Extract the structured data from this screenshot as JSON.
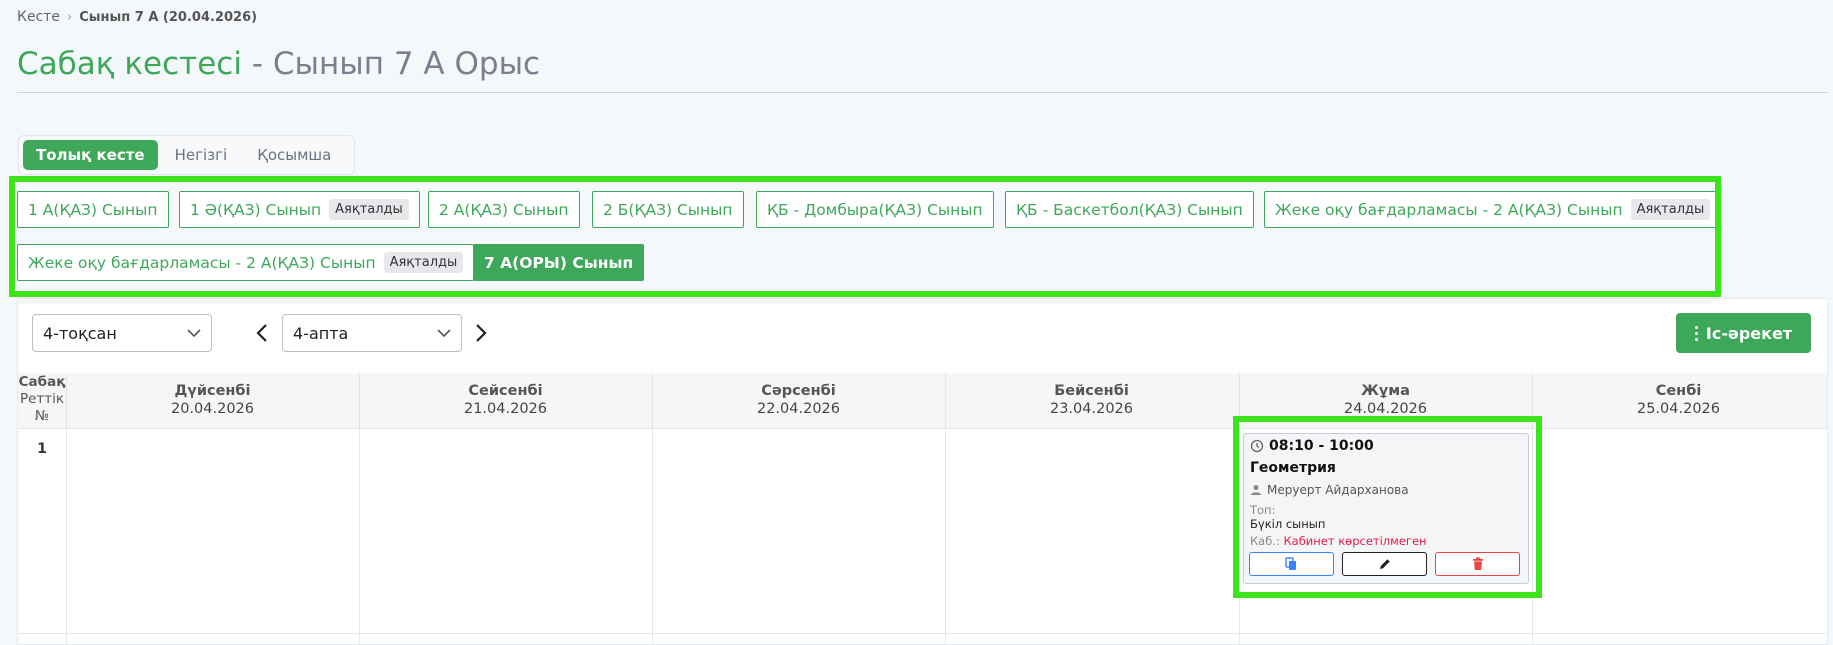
{
  "breadcrumb": {
    "root": "Кесте",
    "current": "Сынып 7 А (20.04.2026)"
  },
  "title": {
    "main": "Сабақ кестесі",
    "suffix": "- Сынып 7 А Орыс"
  },
  "tabs": [
    {
      "label": "Толық кесте",
      "active": true
    },
    {
      "label": "Негізгі",
      "active": false
    },
    {
      "label": "Қосымша",
      "active": false
    }
  ],
  "classes": [
    {
      "label": "1 А(ҚАЗ) Сынып",
      "badge": ""
    },
    {
      "label": "1 Ә(ҚАЗ) Сынып",
      "badge": "Аяқталды"
    },
    {
      "label": "2 А(ҚАЗ) Сынып",
      "badge": ""
    },
    {
      "label": "2 Б(ҚАЗ) Сынып",
      "badge": ""
    },
    {
      "label": "ҚБ - Домбыра(ҚАЗ) Сынып",
      "badge": ""
    },
    {
      "label": "ҚБ - Баскетбол(ҚАЗ) Сынып",
      "badge": ""
    },
    {
      "label": "Жеке оқу бағдарламасы - 2 А(ҚАЗ) Сынып",
      "badge": "Аяқталды"
    },
    {
      "label": "Жеке оқу бағдарламасы - 2 А(ҚАЗ) Сынып",
      "badge": "Аяқталды"
    },
    {
      "label": "7 А(ОРЫ) Сынып",
      "badge": "",
      "active": true
    }
  ],
  "filters": {
    "quarter": "4-тоқсан",
    "week": "4-апта",
    "action_label": "Іс-әрекет"
  },
  "grid": {
    "order_header": [
      "Сабақ",
      "Реттік",
      "№"
    ],
    "days": [
      {
        "name": "Дүйсенбі",
        "date": "20.04.2026"
      },
      {
        "name": "Сейсенбі",
        "date": "21.04.2026"
      },
      {
        "name": "Сәрсенбі",
        "date": "22.04.2026"
      },
      {
        "name": "Бейсенбі",
        "date": "23.04.2026"
      },
      {
        "name": "Жұма",
        "date": "24.04.2026"
      },
      {
        "name": "Сенбі",
        "date": "25.04.2026"
      }
    ],
    "rows": [
      "1"
    ]
  },
  "lesson": {
    "time": "08:10 - 10:00",
    "subject": "Геометрия",
    "teacher": "Меруерт Айдарханова",
    "group_label": "Топ:",
    "group_value": "Бүкіл сынып",
    "room_label": "Каб.:",
    "room_value": "Кабинет көрсетілмеген"
  },
  "colors": {
    "accent": "#3ea85a",
    "highlight": "#3ee41b",
    "danger": "#e11d48"
  }
}
